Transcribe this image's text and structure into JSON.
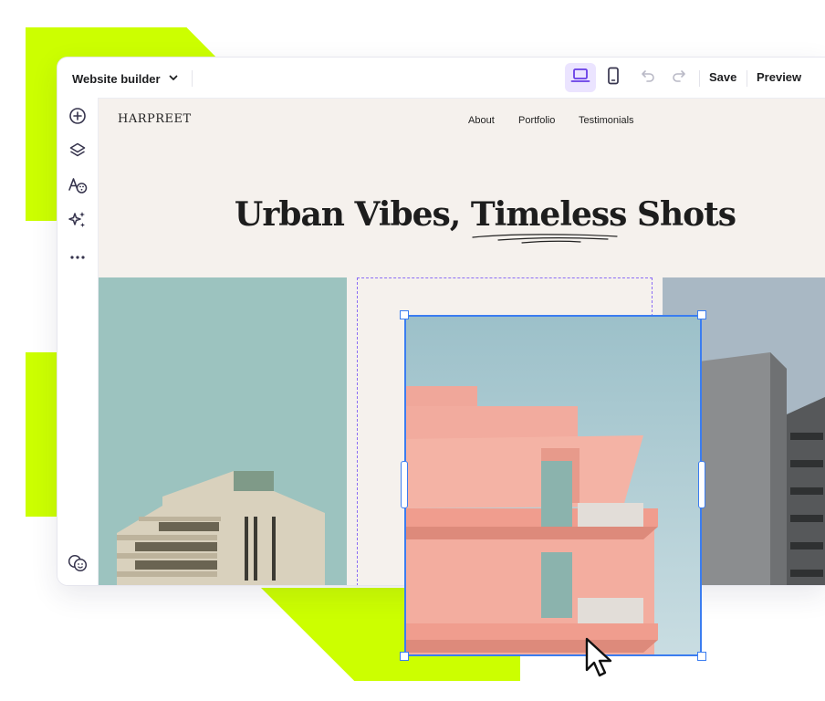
{
  "toolbar": {
    "builder_label": "Website builder",
    "save_label": "Save",
    "preview_label": "Preview",
    "active_device": "desktop"
  },
  "sidebar": {
    "items": [
      "add-icon",
      "layers-icon",
      "typography-palette-icon",
      "ai-sparkle-icon",
      "more-icon"
    ],
    "bottom_item": "face-icon"
  },
  "site": {
    "logo": "HARPREET",
    "nav": [
      "About",
      "Portfolio",
      "Testimonials"
    ],
    "hero": {
      "title_part1": "Urban Vibes, ",
      "title_underlined": "Timeless",
      "title_part2": " Shots"
    }
  },
  "colors": {
    "accent_lime": "#ccff00",
    "selection_blue": "#3b7df0",
    "dashed_purple": "#8b6df5",
    "active_device_bg": "#ebe4ff",
    "canvas_bg": "#f5f1ed"
  }
}
